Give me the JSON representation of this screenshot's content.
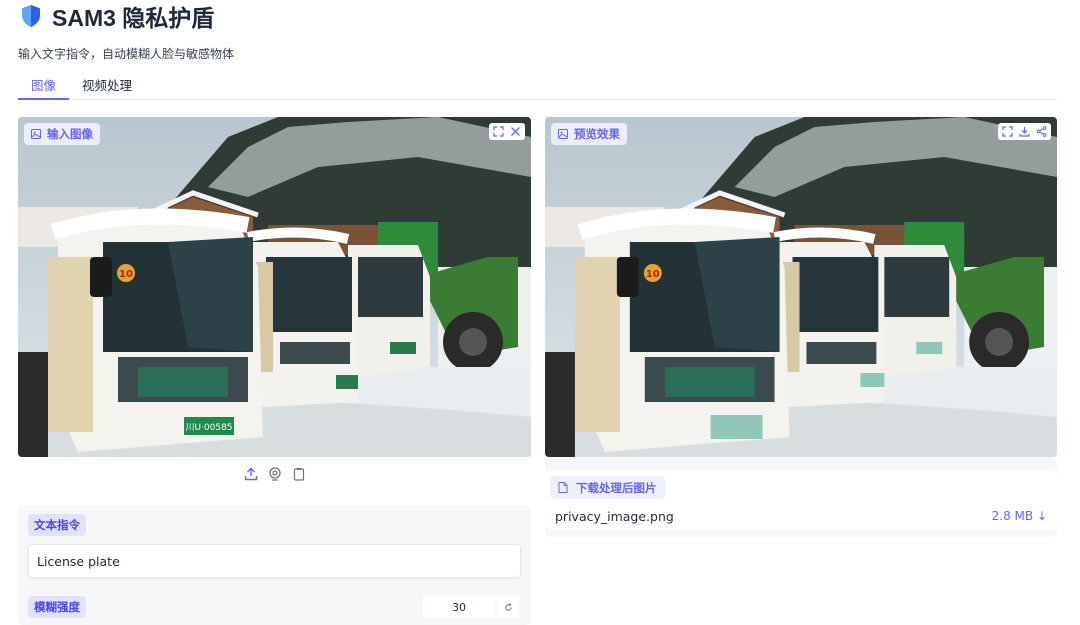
{
  "app": {
    "title": "SAM3 隐私护盾",
    "subtitle": "输入文字指令，自动模糊人脸与敏感物体",
    "accent_color": "#6366f1",
    "icon": "shield-icon"
  },
  "tabs": [
    {
      "label": "图像",
      "active": true
    },
    {
      "label": "视频处理",
      "active": false
    }
  ],
  "input_panel": {
    "label": "输入图像",
    "label_icon": "image-icon",
    "tools": [
      "fullscreen-icon",
      "close-icon"
    ],
    "source_tools": [
      "upload-icon",
      "webcam-icon",
      "clipboard-icon"
    ]
  },
  "output_panel": {
    "label": "预览效果",
    "label_icon": "image-icon",
    "tools": [
      "fullscreen-icon",
      "download-icon",
      "share-icon"
    ]
  },
  "download": {
    "label": "下载处理后图片",
    "label_icon": "file-icon",
    "file_name": "privacy_image.png",
    "file_size": "2.8 MB ↓"
  },
  "prompt": {
    "label": "文本指令",
    "value": "License plate"
  },
  "blur": {
    "label": "模糊强度",
    "value": "30",
    "reset_icon": "reset-icon"
  },
  "scene": {
    "bus_number": "10",
    "plate_text": "川U·00585",
    "plate_color": "#1f8a4c",
    "blur_plate_color": "#8fc7b9"
  }
}
